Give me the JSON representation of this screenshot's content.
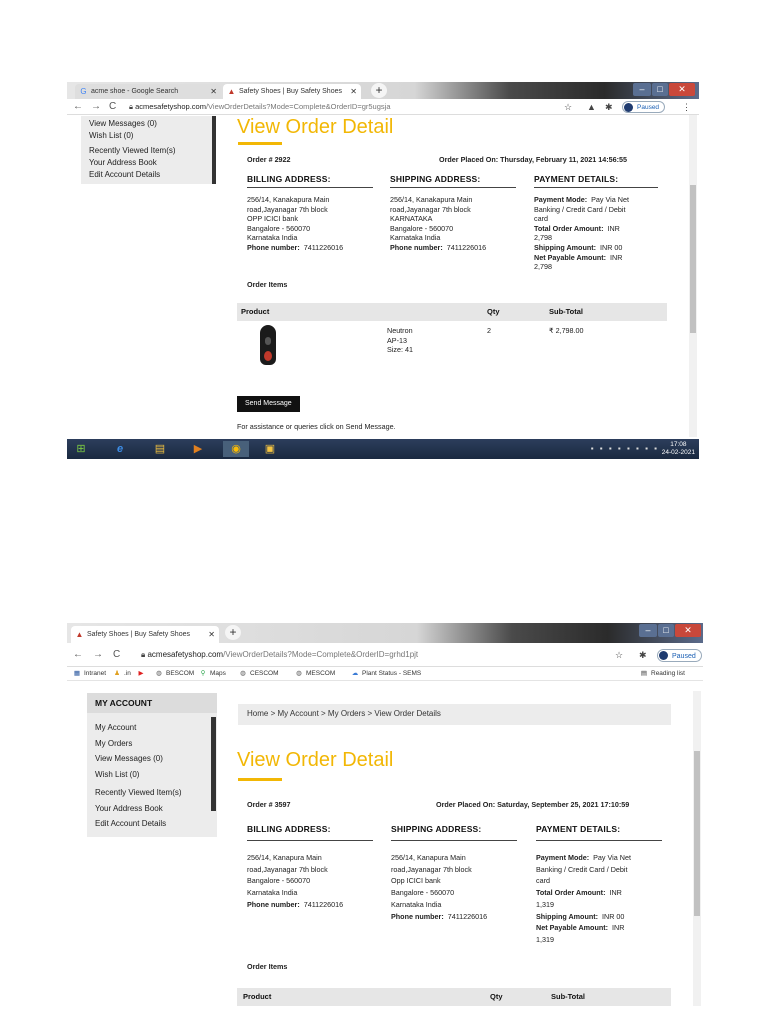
{
  "colors": {
    "accent": "#f2b705",
    "button_bg": "#111111",
    "sidebar_bg": "#ececec"
  },
  "shot1": {
    "tabs": [
      {
        "label": "acme shoe - Google Search",
        "icon": "google-icon"
      },
      {
        "label": "Safety Shoes | Buy Safety Shoes",
        "icon": "acme-logo-icon"
      }
    ],
    "url_host": "acmesafetyshop.com",
    "url_path": "/ViewOrderDetails?Mode=Complete&OrderID=gr5ugsja",
    "profile_status": "Paused",
    "sidebar_items": [
      "View Messages (0)",
      "Wish List (0)",
      "Recently Viewed Item(s)",
      "Your Address Book",
      "Edit Account Details"
    ],
    "title": "View Order Detail",
    "order_no": "Order # 2922",
    "placed_label": "Order Placed On:",
    "placed_on": "Thursday, February 11, 2021 14:56:55",
    "billing_header": "BILLING ADDRESS:",
    "shipping_header": "SHIPPING ADDRESS:",
    "payment_header": "PAYMENT DETAILS:",
    "billing_lines": [
      "256/14, Kanakapura Main",
      "road,Jayanagar 7th block",
      "OPP ICICI bank",
      "Bangalore - 560070",
      "Karnataka India"
    ],
    "shipping_lines": [
      "256/14, Kanakapura Main",
      "road,Jayanagar 7th block",
      "KARNATAKA",
      "Bangalore - 560070",
      "Karnataka India"
    ],
    "phone_label": "Phone number:",
    "phone": "7411226016",
    "pay_mode_label": "Payment Mode:",
    "pay_mode_1": "Pay Via Net",
    "pay_mode_2": "Banking / Credit Card / Debit",
    "pay_mode_3": "card",
    "total_label": "Total Order Amount:",
    "total_1": "INR",
    "total_2": "2,798",
    "shipping_label": "Shipping Amount:",
    "shipping_amt": "INR 00",
    "net_label": "Net Payable Amount:",
    "net_1": "INR",
    "net_2": "2,798",
    "order_items": "Order Items",
    "col_product": "Product",
    "col_qty": "Qty",
    "col_subtotal": "Sub-Total",
    "item_lines": [
      "Neutron",
      "AP-13",
      "Size: 41"
    ],
    "item_qty": "2",
    "item_subtotal": "₹ 2,798.00",
    "send_message": "Send Message",
    "assist": "For assistance or queries click on Send Message.",
    "clock_time": "17:08",
    "clock_date": "24-02-2021"
  },
  "shot2": {
    "tabs": [
      {
        "label": "Safety Shoes | Buy Safety Shoes",
        "icon": "acme-logo-icon"
      }
    ],
    "url_host": "acmesafetyshop.com",
    "url_path": "/ViewOrderDetails?Mode=Complete&OrderID=grhd1pjt",
    "profile_status": "Paused",
    "bookmarks": [
      {
        "label": "Intranet",
        "icon": "intranet-icon"
      },
      {
        "label": ".in",
        "icon": "person-icon"
      },
      {
        "label": "",
        "icon": "youtube-icon"
      },
      {
        "label": "BESCOM",
        "icon": "globe-icon"
      },
      {
        "label": "Maps",
        "icon": "maps-icon"
      },
      {
        "label": "CESCOM",
        "icon": "globe-icon"
      },
      {
        "label": "MESCOM",
        "icon": "globe-icon"
      },
      {
        "label": "Plant Status - SEMS",
        "icon": "cloud-icon"
      }
    ],
    "reading_list": "Reading list",
    "sidebar_title": "MY ACCOUNT",
    "sidebar_items": [
      "My Account",
      "My Orders",
      "View Messages (0)",
      "Wish List (0)",
      "Recently Viewed Item(s)",
      "Your Address Book",
      "Edit Account Details"
    ],
    "breadcrumb": "Home > My Account > My Orders > View Order Details",
    "title": "View Order Detail",
    "order_no": "Order # 3597",
    "placed_label": "Order Placed On:",
    "placed_on": "Saturday, September 25, 2021 17:10:59",
    "billing_header": "BILLING ADDRESS:",
    "shipping_header": "SHIPPING ADDRESS:",
    "payment_header": "PAYMENT DETAILS:",
    "billing_lines": [
      "256/14, Kanapura Main",
      "road,Jayanagar 7th block",
      "Bangalore - 560070",
      "Karnataka India"
    ],
    "shipping_lines": [
      "256/14, Kanapura Main",
      "road,Jayanagar 7th block",
      "Opp ICICI bank",
      "Bangalore - 560070",
      "Karnataka India"
    ],
    "phone_label": "Phone number:",
    "phone": "7411226016",
    "pay_mode_label": "Payment Mode:",
    "pay_mode_1": "Pay Via Net",
    "pay_mode_2": "Banking / Credit Card / Debit",
    "pay_mode_3": "card",
    "total_label": "Total Order Amount:",
    "total_1": "INR",
    "total_2": "1,319",
    "shipping_label": "Shipping Amount:",
    "shipping_amt": "INR 00",
    "net_label": "Net Payable Amount:",
    "net_1": "INR",
    "net_2": "1,319",
    "order_items": "Order Items",
    "col_product": "Product",
    "col_qty": "Qty",
    "col_subtotal": "Sub-Total"
  }
}
